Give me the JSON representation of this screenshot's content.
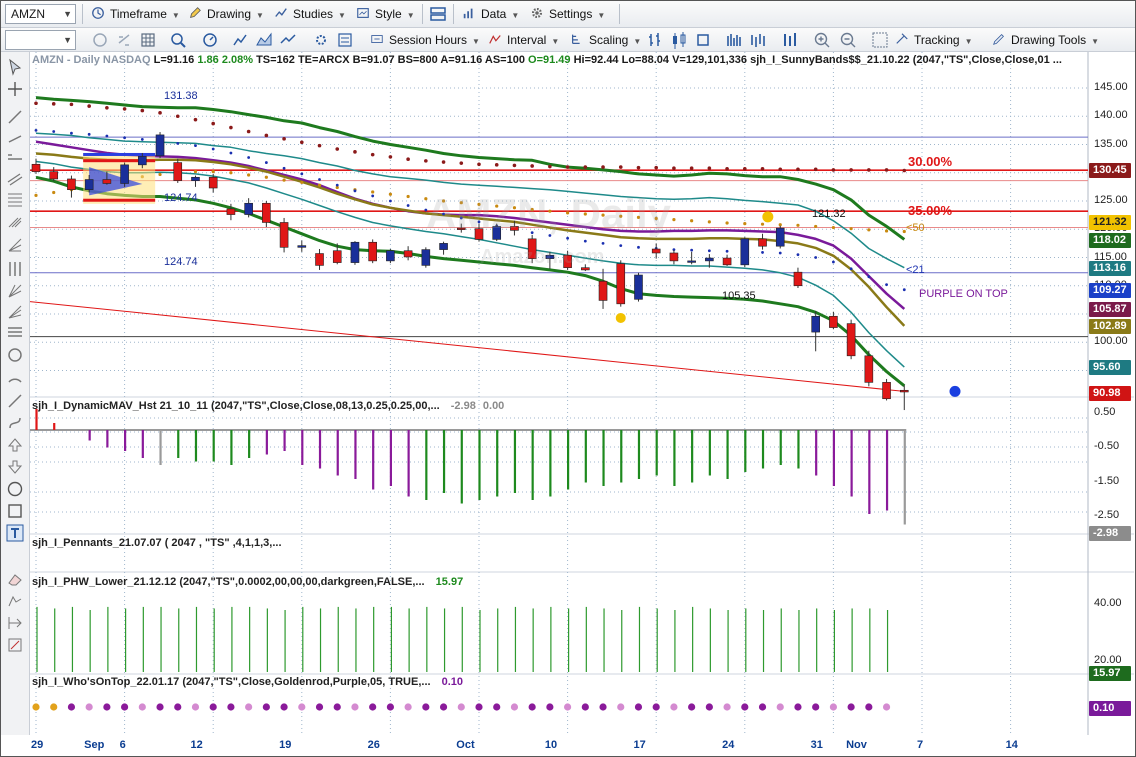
{
  "toolbar": {
    "symbol": "AMZN",
    "timeframe": "Timeframe",
    "drawing": "Drawing",
    "studies": "Studies",
    "style": "Style",
    "data": "Data",
    "settings": "Settings",
    "session_hours": "Session Hours",
    "interval": "Interval",
    "scaling": "Scaling",
    "tracking": "Tracking",
    "drawing_tools": "Drawing Tools"
  },
  "chart": {
    "header": "AMZN - Daily  NASDAQ",
    "stats": [
      {
        "label": "L=91.16",
        "color": "#1a1a1a"
      },
      {
        "label": "1.86",
        "color": "#1d8a1d"
      },
      {
        "label": "2.08%",
        "color": "#1d8a1d"
      },
      {
        "label": "TS=162",
        "color": "#1a1a1a"
      },
      {
        "label": "TE=ARCX",
        "color": "#1a1a1a"
      },
      {
        "label": "B=91.07",
        "color": "#1a1a1a"
      },
      {
        "label": "BS=800",
        "color": "#1a1a1a"
      },
      {
        "label": "A=91.16",
        "color": "#1a1a1a"
      },
      {
        "label": "AS=100",
        "color": "#1a1a1a"
      },
      {
        "label": "O=91.49",
        "color": "#1d8a1d"
      },
      {
        "label": "Hi=92.44",
        "color": "#1a1a1a"
      },
      {
        "label": "Lo=88.04",
        "color": "#1a1a1a"
      },
      {
        "label": "V=129,101,336",
        "color": "#1a1a1a"
      },
      {
        "label": "sjh_I_SunnyBands$$_21.10.22 (2047,\"TS\",Close,Close,01 ...",
        "color": "#1a1a1a"
      }
    ],
    "watermark": "AMZN, Daily",
    "watermark_sub": "Amazon.com",
    "annotations": {
      "a131": "131.38",
      "a124a": "124.74",
      "a124b": "124.74",
      "a121": "121.32",
      "a105": "105.35",
      "p30": "30.00%",
      "p35": "35.00%",
      "lt50": "<50",
      "lt21": "<21",
      "purple": "PURPLE ON TOP"
    },
    "price_axis": [
      "145.00",
      "140.00",
      "135.00",
      "130.00",
      "125.00",
      "120.00",
      "115.00",
      "110.00",
      "105.00",
      "100.00",
      "95.00"
    ],
    "price_tags": [
      {
        "label": "130.45",
        "color": "#8b1a1a"
      },
      {
        "label": "121.32",
        "color": "#f2c200"
      },
      {
        "label": "118.02",
        "color": "#1e6b1e"
      },
      {
        "label": "113.16",
        "color": "#1e7a82"
      },
      {
        "label": "109.27",
        "color": "#1a40c8"
      },
      {
        "label": "105.87",
        "color": "#7a1a4a"
      },
      {
        "label": "102.89",
        "color": "#8a7a18"
      },
      {
        "label": "95.60",
        "color": "#1e7a82"
      },
      {
        "label": "90.98",
        "color": "#d01414"
      }
    ],
    "candles": [
      {
        "o": 131.5,
        "h": 132.5,
        "l": 129.8,
        "c": 130.2
      },
      {
        "o": 130.2,
        "h": 131.0,
        "l": 128.5,
        "c": 128.9
      },
      {
        "o": 128.9,
        "h": 129.5,
        "l": 125.6,
        "c": 127.0
      },
      {
        "o": 127.0,
        "h": 129.6,
        "l": 126.5,
        "c": 128.8
      },
      {
        "o": 128.8,
        "h": 130.2,
        "l": 127.9,
        "c": 128.1
      },
      {
        "o": 128.1,
        "h": 131.8,
        "l": 127.5,
        "c": 131.4
      },
      {
        "o": 131.4,
        "h": 133.5,
        "l": 130.8,
        "c": 132.9
      },
      {
        "o": 133.0,
        "h": 137.2,
        "l": 132.6,
        "c": 136.7
      },
      {
        "o": 131.8,
        "h": 132.5,
        "l": 128.2,
        "c": 128.6
      },
      {
        "o": 128.6,
        "h": 129.5,
        "l": 127.5,
        "c": 129.2
      },
      {
        "o": 129.2,
        "h": 129.8,
        "l": 126.5,
        "c": 127.3
      },
      {
        "o": 123.6,
        "h": 124.5,
        "l": 121.6,
        "c": 122.6
      },
      {
        "o": 122.6,
        "h": 125.5,
        "l": 122.1,
        "c": 124.6
      },
      {
        "o": 124.6,
        "h": 125.0,
        "l": 120.4,
        "c": 121.2
      },
      {
        "o": 121.2,
        "h": 122.0,
        "l": 115.9,
        "c": 116.8
      },
      {
        "o": 116.8,
        "h": 118.0,
        "l": 116.0,
        "c": 117.1
      },
      {
        "o": 115.7,
        "h": 116.5,
        "l": 112.8,
        "c": 113.6
      },
      {
        "o": 116.2,
        "h": 117.5,
        "l": 113.8,
        "c": 114.1
      },
      {
        "o": 114.1,
        "h": 117.9,
        "l": 113.7,
        "c": 117.7
      },
      {
        "o": 117.7,
        "h": 118.2,
        "l": 114.0,
        "c": 114.4
      },
      {
        "o": 114.4,
        "h": 116.5,
        "l": 114.0,
        "c": 116.2
      },
      {
        "o": 116.2,
        "h": 117.0,
        "l": 114.5,
        "c": 115.1
      },
      {
        "o": 113.6,
        "h": 116.8,
        "l": 113.2,
        "c": 116.4
      },
      {
        "o": 116.4,
        "h": 117.8,
        "l": 115.5,
        "c": 117.5
      },
      {
        "o": 120.2,
        "h": 121.0,
        "l": 119.4,
        "c": 120.1
      },
      {
        "o": 120.1,
        "h": 121.0,
        "l": 117.8,
        "c": 118.2
      },
      {
        "o": 118.2,
        "h": 121.0,
        "l": 117.9,
        "c": 120.5
      },
      {
        "o": 120.5,
        "h": 121.5,
        "l": 118.9,
        "c": 119.8
      },
      {
        "o": 118.3,
        "h": 119.0,
        "l": 114.0,
        "c": 114.8
      },
      {
        "o": 114.8,
        "h": 116.0,
        "l": 113.0,
        "c": 115.4
      },
      {
        "o": 115.4,
        "h": 116.2,
        "l": 112.8,
        "c": 113.2
      },
      {
        "o": 113.2,
        "h": 113.8,
        "l": 112.6,
        "c": 112.8
      },
      {
        "o": 110.8,
        "h": 113.0,
        "l": 105.9,
        "c": 107.4
      },
      {
        "o": 113.9,
        "h": 114.5,
        "l": 106.3,
        "c": 106.8
      },
      {
        "o": 107.6,
        "h": 112.3,
        "l": 107.2,
        "c": 111.9
      },
      {
        "o": 116.5,
        "h": 117.5,
        "l": 114.8,
        "c": 115.8
      },
      {
        "o": 115.8,
        "h": 116.3,
        "l": 113.8,
        "c": 114.4
      },
      {
        "o": 114.4,
        "h": 116.0,
        "l": 113.8,
        "c": 114.4
      },
      {
        "o": 114.4,
        "h": 115.6,
        "l": 113.2,
        "c": 114.9
      },
      {
        "o": 114.9,
        "h": 115.5,
        "l": 113.5,
        "c": 113.7
      },
      {
        "o": 113.7,
        "h": 118.6,
        "l": 113.3,
        "c": 118.3
      },
      {
        "o": 118.3,
        "h": 119.2,
        "l": 116.4,
        "c": 117.0
      },
      {
        "o": 117.0,
        "h": 120.6,
        "l": 116.6,
        "c": 120.2
      },
      {
        "o": 112.4,
        "h": 113.2,
        "l": 109.6,
        "c": 110.0
      },
      {
        "o": 101.8,
        "h": 105.5,
        "l": 98.4,
        "c": 104.6
      },
      {
        "o": 104.6,
        "h": 105.4,
        "l": 102.3,
        "c": 102.6
      },
      {
        "o": 103.3,
        "h": 104.0,
        "l": 97.0,
        "c": 97.6
      },
      {
        "o": 97.6,
        "h": 98.5,
        "l": 92.2,
        "c": 92.9
      },
      {
        "o": 92.9,
        "h": 93.5,
        "l": 89.7,
        "c": 90.0
      },
      {
        "o": 91.5,
        "h": 92.4,
        "l": 88.0,
        "c": 91.2
      }
    ],
    "hist1": [
      0.6,
      0.2,
      0,
      -0.3,
      -0.5,
      -0.6,
      -0.8,
      -1.0,
      -0.8,
      -0.9,
      -0.9,
      -1.0,
      -0.8,
      -0.7,
      -0.6,
      -1.0,
      -1.1,
      -1.3,
      -1.4,
      -1.7,
      -1.6,
      -1.9,
      -2.0,
      -1.8,
      -2.1,
      -2.0,
      -1.9,
      -1.8,
      -2.0,
      -1.9,
      -1.7,
      -1.5,
      -1.6,
      -1.5,
      -1.4,
      -1.3,
      -1.6,
      -1.5,
      -1.3,
      -1.4,
      -1.2,
      -1.1,
      -1.0,
      -1.1,
      -1.3,
      -1.6,
      -1.9,
      -2.4,
      -2.3,
      -2.7,
      -2.98
    ],
    "hist1_value": "-2.98",
    "hist1_value2": "0.00",
    "hist2": [],
    "hist3": [
      42,
      41,
      42,
      40,
      42,
      41,
      42,
      42,
      41,
      42,
      41,
      42,
      42,
      41,
      40,
      42,
      41,
      42,
      41,
      42,
      42,
      41,
      42,
      41,
      42,
      40,
      41,
      42,
      41,
      42,
      41,
      42,
      41,
      40,
      42,
      41,
      40,
      42,
      41,
      40,
      41,
      40,
      41,
      40,
      41,
      40,
      41,
      41,
      40
    ],
    "dots_gold": 2,
    "dots_purple": 47
  },
  "indicators": {
    "dyn": "sjh_I_DynamicMAV_Hst 21_10_11 (2047,\"TS\",Close,Close,08,13,0.25,0.25,00,...",
    "pennants": "sjh_I_Pennants_21.07.07 ( 2047 , \"TS\" ,4,1,1,3,...",
    "phw": "sjh_I_PHW_Lower_21.12.12 (2047,\"TS\",0.0002,00,00,00,darkgreen,FALSE,...",
    "phw_value": "15.97",
    "who": "sjh_I_Who'sOnTop_22.01.17 (2047,\"TS\",Close,Goldenrod,Purple,05, TRUE,...",
    "who_value": "0.10"
  },
  "panel_axis": {
    "dyn": [
      "0.50",
      "-0.50",
      "-1.50",
      "-2.50"
    ],
    "dyn_tag": "-2.98",
    "phw": [
      "40.00",
      "20.00"
    ],
    "phw_tag": "15.97",
    "who_tag": "0.10"
  },
  "x_axis": [
    {
      "label": "29",
      "i": 0
    },
    {
      "label": "Sep",
      "i": 3
    },
    {
      "label": "6",
      "i": 5
    },
    {
      "label": "12",
      "i": 9
    },
    {
      "label": "19",
      "i": 14
    },
    {
      "label": "26",
      "i": 19
    },
    {
      "label": "Oct",
      "i": 24
    },
    {
      "label": "10",
      "i": 29
    },
    {
      "label": "17",
      "i": 34
    },
    {
      "label": "24",
      "i": 39
    },
    {
      "label": "31",
      "i": 44
    },
    {
      "label": "Nov",
      "i": 46
    },
    {
      "label": "7",
      "i": 50
    },
    {
      "label": "14",
      "i": 55
    }
  ],
  "colors": {
    "up": "#1a2f9a",
    "down": "#e01717",
    "green_band": "#1e7a1e",
    "teal_band": "#1e8a8a",
    "purple": "#7a1a9a",
    "olive": "#8a7a18",
    "red_line": "#e01717",
    "grid": "#9fb6cc"
  }
}
